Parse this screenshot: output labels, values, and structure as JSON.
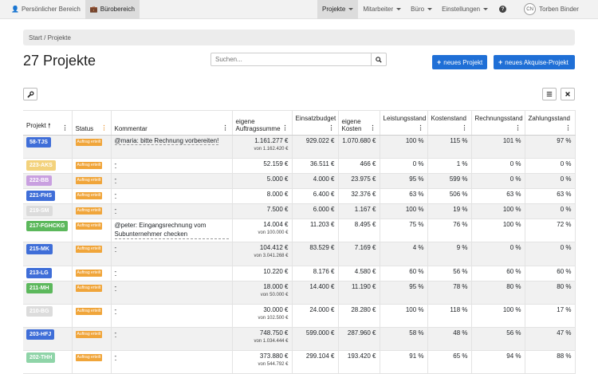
{
  "topbar": {
    "left_tabs": [
      {
        "label": "Persönlicher Bereich",
        "icon": "user-icon"
      },
      {
        "label": "Bürobereich",
        "icon": "briefcase-icon"
      }
    ],
    "right_menus": [
      "Projekte",
      "Mitarbeiter",
      "Büro",
      "Einstellungen"
    ],
    "help_label": "?",
    "user_initials": "CN",
    "user_name": "Torben Binder"
  },
  "breadcrumb": "Start / Projekte",
  "page_title": "27 Projekte",
  "search": {
    "placeholder": "Suchen..."
  },
  "buttons": {
    "new_project": "neues Projekt",
    "new_acquisition": "neues Akquise-Projekt"
  },
  "table": {
    "headers": [
      "Projekt",
      "Status",
      "Kommentar",
      "eigene Auftragssumme",
      "Einsatzbudget",
      "eigene Kosten",
      "Leistungsstand",
      "Kostenstand",
      "Rechnungsstand",
      "Zahlungsstand"
    ],
    "status_label": "Auftrag erteilt",
    "rows": [
      {
        "tag": "58-TJS",
        "color": "#3f6ed8",
        "comment": "@maria: bitte Rechnung vorbereiten!",
        "sum": "1.161.277 €",
        "sum_sub": "von 1.162.420 €",
        "budget": "929.022 €",
        "cost": "1.070.680 €",
        "l": "100 %",
        "k": "115 %",
        "r": "101 %",
        "z": "97 %",
        "gray": true
      },
      {
        "tag": "223-AKS",
        "color": "#f3d27c",
        "comment": "-",
        "sum": "52.159 €",
        "sum_sub": "",
        "budget": "36.511 €",
        "cost": "466 €",
        "l": "0 %",
        "k": "1 %",
        "r": "0 %",
        "z": "0 %",
        "gray": false
      },
      {
        "tag": "222-BB",
        "color": "#c9a0e0",
        "comment": "-",
        "sum": "5.000 €",
        "sum_sub": "",
        "budget": "4.000 €",
        "cost": "23.975 €",
        "l": "95 %",
        "k": "599 %",
        "r": "0 %",
        "z": "0 %",
        "gray": true
      },
      {
        "tag": "221-FHS",
        "color": "#3f6ed8",
        "comment": "-",
        "sum": "8.000 €",
        "sum_sub": "",
        "budget": "6.400 €",
        "cost": "32.376 €",
        "l": "63 %",
        "k": "506 %",
        "r": "63 %",
        "z": "63 %",
        "gray": false
      },
      {
        "tag": "219-SM",
        "color": "#dcdcdc",
        "comment": "-",
        "sum": "7.500 €",
        "sum_sub": "",
        "budget": "6.000 €",
        "cost": "1.167 €",
        "l": "100 %",
        "k": "19 %",
        "r": "100 %",
        "z": "0 %",
        "gray": true
      },
      {
        "tag": "217-FGHCKG",
        "color": "#5cb85c",
        "comment": "@peter: Eingangsrechnung vom Subunternehmer checken",
        "sum": "14.004 €",
        "sum_sub": "von 100.000 €",
        "budget": "11.203 €",
        "cost": "8.495 €",
        "l": "75 %",
        "k": "76 %",
        "r": "100 %",
        "z": "72 %",
        "gray": false
      },
      {
        "tag": "215-MK",
        "color": "#3f6ed8",
        "comment": "-",
        "sum": "104.412 €",
        "sum_sub": "von 3.041.268 €",
        "budget": "83.529 €",
        "cost": "7.169 €",
        "l": "4 %",
        "k": "9 %",
        "r": "0 %",
        "z": "0 %",
        "gray": true
      },
      {
        "tag": "213-LG",
        "color": "#3f6ed8",
        "comment": "-",
        "sum": "10.220 €",
        "sum_sub": "",
        "budget": "8.176 €",
        "cost": "4.580 €",
        "l": "60 %",
        "k": "56 %",
        "r": "60 %",
        "z": "60 %",
        "gray": false
      },
      {
        "tag": "211-MH",
        "color": "#5cb85c",
        "comment": "-",
        "sum": "18.000 €",
        "sum_sub": "von 50.000 €",
        "budget": "14.400 €",
        "cost": "11.190 €",
        "l": "95 %",
        "k": "78 %",
        "r": "80 %",
        "z": "80 %",
        "gray": true
      },
      {
        "tag": "210-BG",
        "color": "#dcdcdc",
        "comment": "-",
        "sum": "30.000 €",
        "sum_sub": "von 102.500 €",
        "budget": "24.000 €",
        "cost": "28.280 €",
        "l": "100 %",
        "k": "118 %",
        "r": "100 %",
        "z": "17 %",
        "gray": false
      },
      {
        "tag": "203-HFJ",
        "color": "#3f6ed8",
        "comment": "-",
        "sum": "748.750 €",
        "sum_sub": "von 1.034.444 €",
        "budget": "599.000 €",
        "cost": "287.960 €",
        "l": "58 %",
        "k": "48 %",
        "r": "56 %",
        "z": "47 %",
        "gray": true
      },
      {
        "tag": "202-THH",
        "color": "#8fd4a8",
        "comment": "-",
        "sum": "373.880 €",
        "sum_sub": "von 544.792 €",
        "budget": "299.104 €",
        "cost": "193.420 €",
        "l": "91 %",
        "k": "65 %",
        "r": "94 %",
        "z": "88 %",
        "gray": false
      }
    ]
  }
}
